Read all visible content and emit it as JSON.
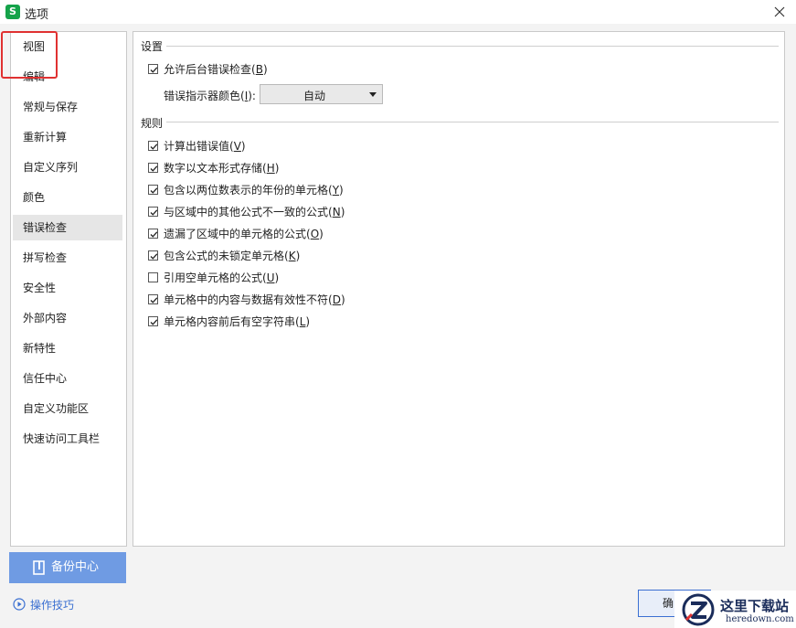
{
  "window": {
    "title": "选项",
    "app_icon_letter": "S"
  },
  "sidebar": {
    "items": [
      {
        "label": "视图"
      },
      {
        "label": "编辑"
      },
      {
        "label": "常规与保存"
      },
      {
        "label": "重新计算"
      },
      {
        "label": "自定义序列"
      },
      {
        "label": "颜色"
      },
      {
        "label": "错误检查",
        "active": true
      },
      {
        "label": "拼写检查"
      },
      {
        "label": "安全性"
      },
      {
        "label": "外部内容"
      },
      {
        "label": "新特性"
      },
      {
        "label": "信任中心"
      },
      {
        "label": "自定义功能区"
      },
      {
        "label": "快速访问工具栏"
      }
    ],
    "backup_button": "备份中心",
    "tips_link": "操作技巧"
  },
  "settings": {
    "section_title": "设置",
    "allow_background": {
      "label": "允许后台错误检查",
      "key": "B",
      "checked": true
    },
    "indicator_color": {
      "label": "错误指示器颜色",
      "key": "I",
      "value": "自动"
    }
  },
  "rules": {
    "section_title": "规则",
    "items": [
      {
        "label": "计算出错误值",
        "key": "V",
        "checked": true
      },
      {
        "label": "数字以文本形式存储",
        "key": "H",
        "checked": true
      },
      {
        "label": "包含以两位数表示的年份的单元格",
        "key": "Y",
        "checked": true
      },
      {
        "label": "与区域中的其他公式不一致的公式",
        "key": "N",
        "checked": true
      },
      {
        "label": "遗漏了区域中的单元格的公式",
        "key": "O",
        "checked": true
      },
      {
        "label": "包含公式的未锁定单元格",
        "key": "K",
        "checked": true
      },
      {
        "label": "引用空单元格的公式",
        "key": "U",
        "checked": false
      },
      {
        "label": "单元格中的内容与数据有效性不符",
        "key": "D",
        "checked": true
      },
      {
        "label": "单元格内容前后有空字符串",
        "key": "L",
        "checked": true
      }
    ]
  },
  "footer": {
    "ok_button": "确"
  },
  "watermark": {
    "text_cn": "这里下载站",
    "text_en": "heredown.com"
  }
}
